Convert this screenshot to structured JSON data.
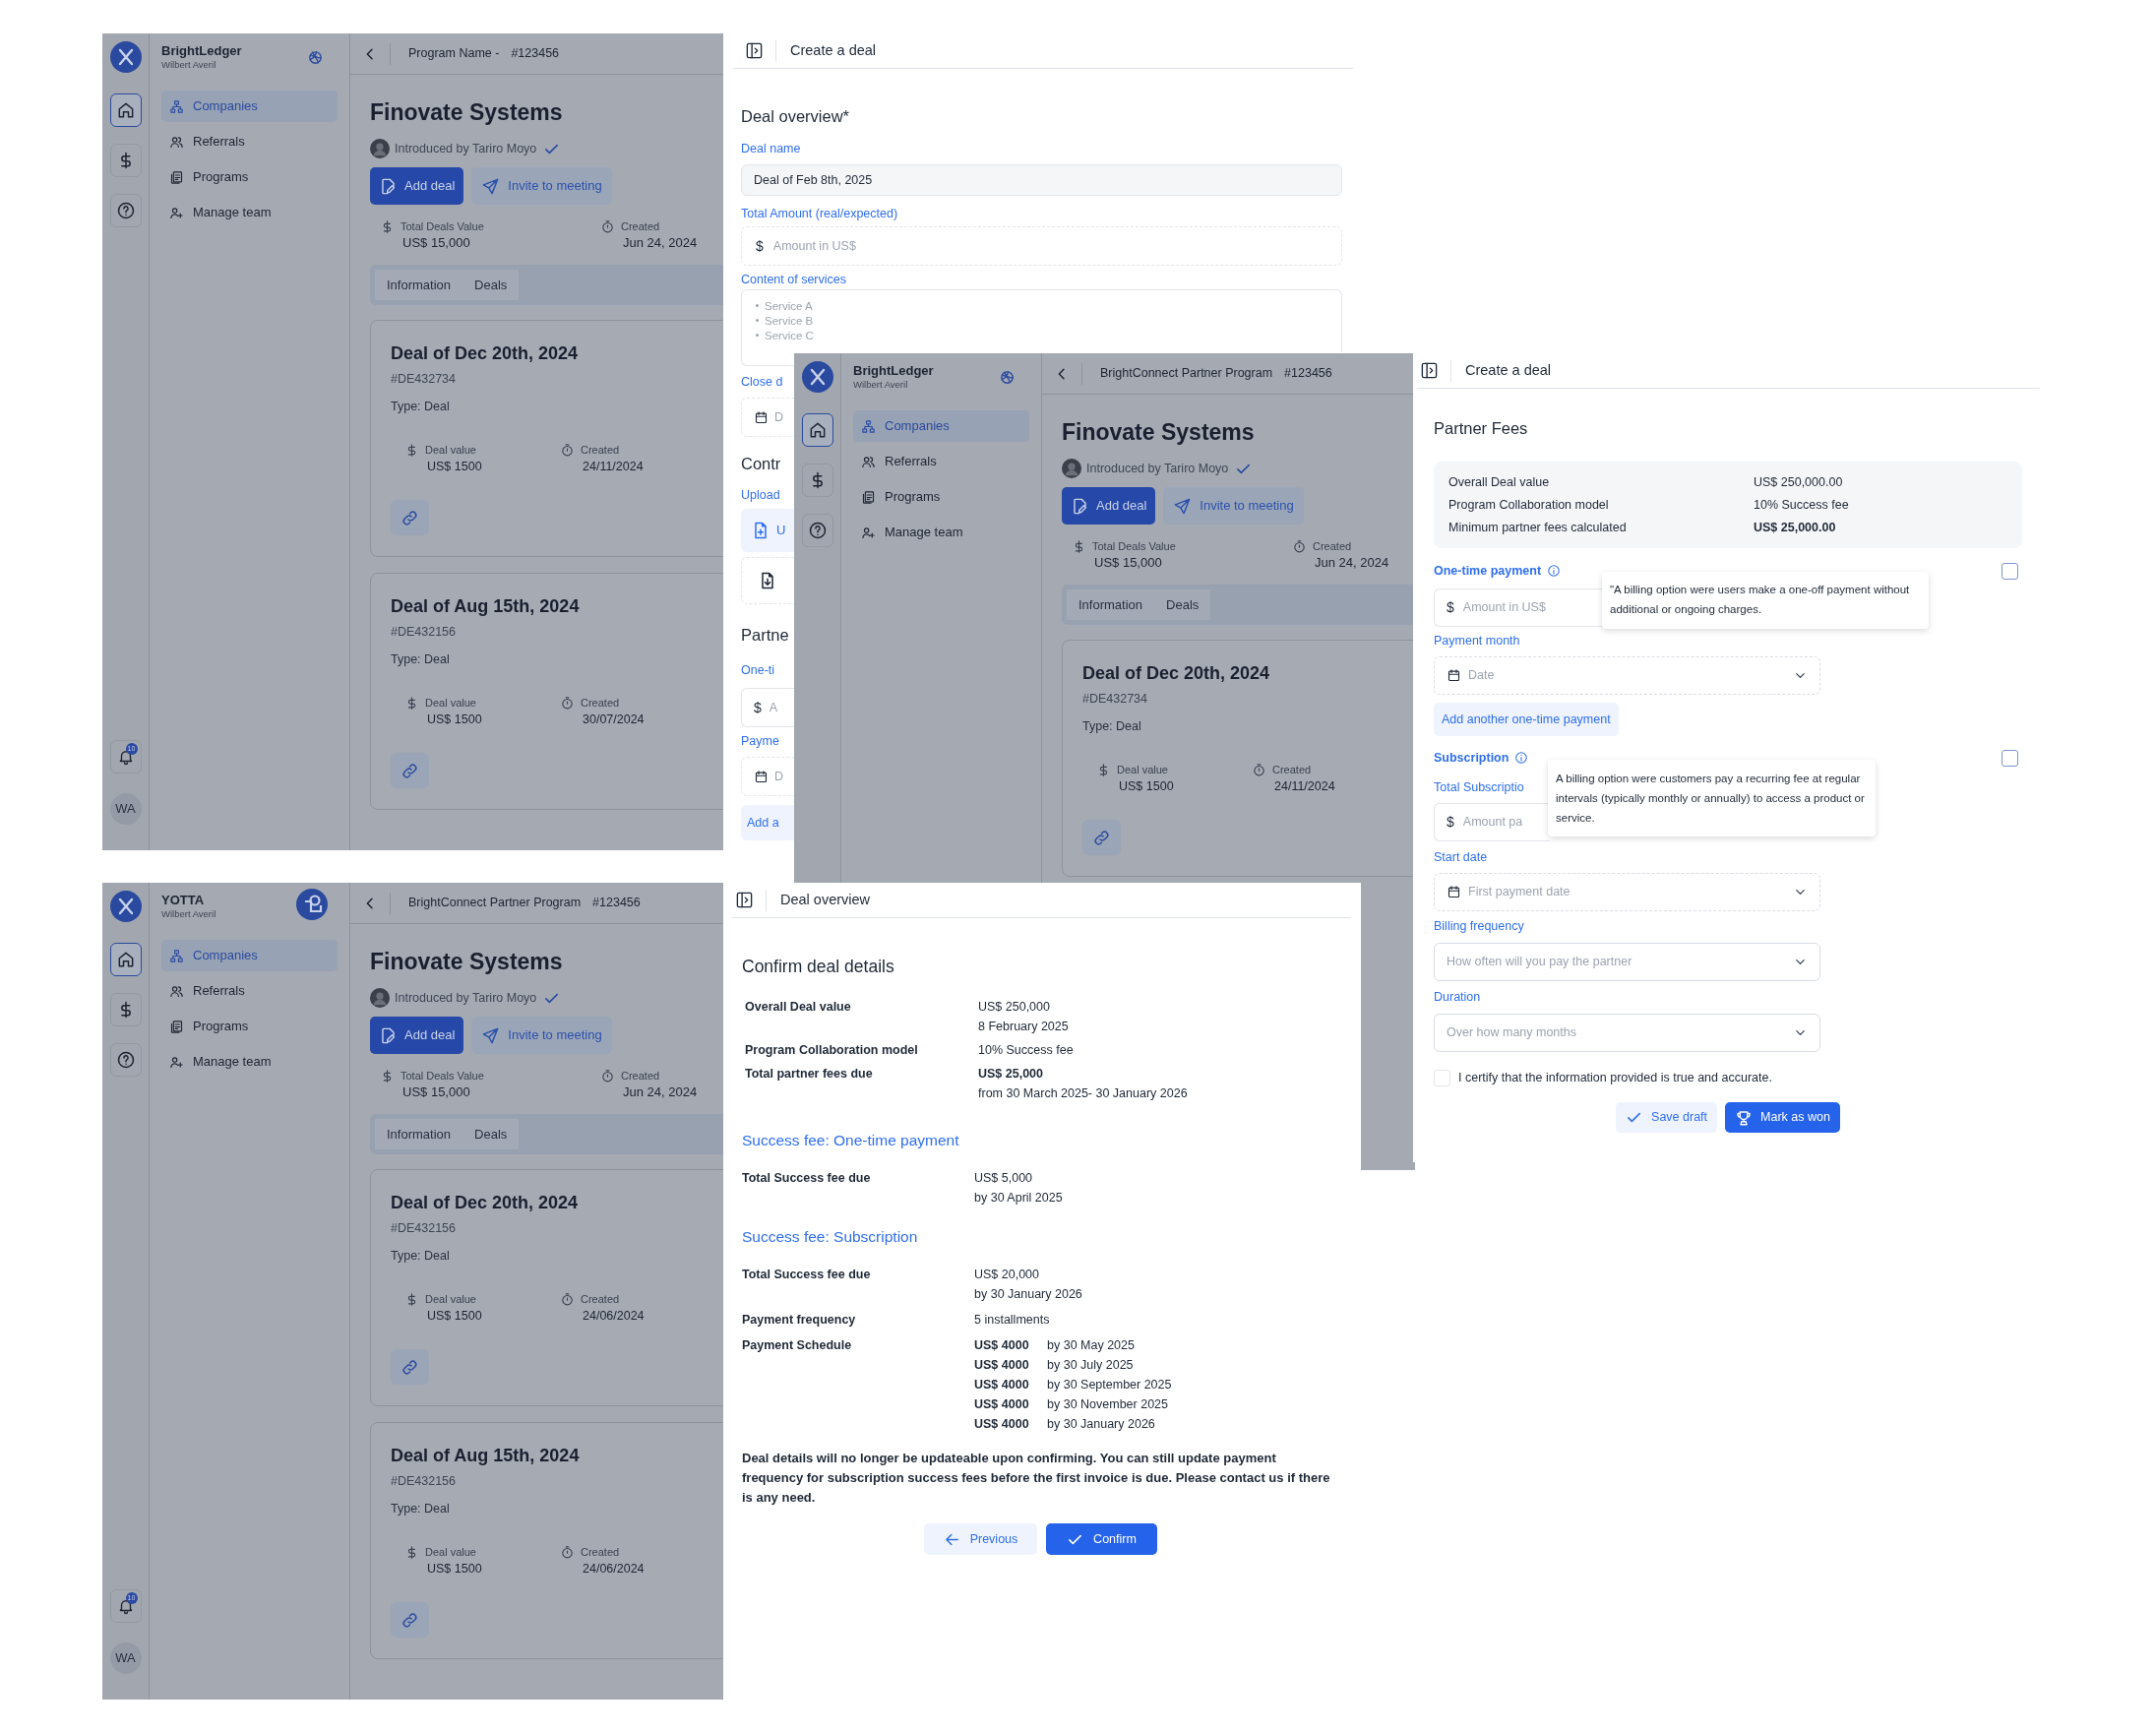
{
  "app_screens": [
    {
      "brand": "BrightLedger",
      "logo": {
        "kind": "knot"
      },
      "user": "Wilbert Averil",
      "program": "Program Name -",
      "program_id": "#123456",
      "rail": [
        {
          "kind": "home",
          "selected": true
        },
        {
          "kind": "dollar",
          "selected": false
        },
        {
          "kind": "help",
          "selected": false
        }
      ],
      "notification_count": "10",
      "avatar": "WA",
      "nav": [
        {
          "kind": "org",
          "label": "Companies",
          "selected": true
        },
        {
          "kind": "users",
          "label": "Referrals",
          "selected": false
        },
        {
          "kind": "docs",
          "label": "Programs",
          "selected": false
        },
        {
          "kind": "userplus",
          "label": "Manage team",
          "selected": false
        }
      ],
      "company": "Finovate Systems",
      "introduced_by": "Introduced by Tariro Moyo",
      "actions": [
        "Add deal",
        "Invite to meeting"
      ],
      "stats": [
        {
          "kind": "dollar",
          "label": "Total Deals Value",
          "value": "US$ 15,000"
        },
        {
          "kind": "timer",
          "label": "Created",
          "value": "Jun 24, 2024"
        }
      ],
      "tabs": [
        {
          "label": "Information",
          "selected": false
        },
        {
          "label": "Deals",
          "selected": false
        }
      ],
      "deals": [
        {
          "title": "Deal of Dec 20th, 2024",
          "id": "#DE432734",
          "type": "Type: Deal",
          "stats": [
            {
              "kind": "dollar",
              "label": "Deal value",
              "value": "US$ 1500"
            },
            {
              "kind": "timer",
              "label": "Created",
              "value": "24/11/2024"
            }
          ]
        },
        {
          "title": "Deal of Aug 15th, 2024",
          "id": "#DE432156",
          "type": "Type: Deal",
          "stats": [
            {
              "kind": "dollar",
              "label": "Deal value",
              "value": "US$ 1500"
            },
            {
              "kind": "timer",
              "label": "Created",
              "value": "30/07/2024"
            }
          ]
        }
      ]
    },
    {
      "brand": "BrightLedger",
      "logo": {
        "kind": "knot"
      },
      "user": "Wilbert Averil",
      "program": "BrightConnect Partner Program",
      "program_id": "#123456",
      "rail": [
        {
          "kind": "home",
          "selected": true
        },
        {
          "kind": "dollar",
          "selected": false
        },
        {
          "kind": "help",
          "selected": false
        }
      ],
      "nav": [
        {
          "kind": "org",
          "label": "Companies",
          "selected": true
        },
        {
          "kind": "users",
          "label": "Referrals",
          "selected": false
        },
        {
          "kind": "docs",
          "label": "Programs",
          "selected": false
        },
        {
          "kind": "userplus",
          "label": "Manage team",
          "selected": false
        }
      ],
      "company": "Finovate Systems",
      "introduced_by": "Introduced by Tariro Moyo",
      "actions": [
        "Add deal",
        "Invite to meeting"
      ],
      "stats": [
        {
          "kind": "dollar",
          "label": "Total Deals Value",
          "value": "US$ 15,000"
        },
        {
          "kind": "timer",
          "label": "Created",
          "value": "Jun 24, 2024"
        }
      ],
      "tabs": [
        {
          "label": "Information",
          "selected": false
        },
        {
          "label": "Deals",
          "selected": false
        }
      ],
      "deals": [
        {
          "title": "Deal of Dec 20th, 2024",
          "id": "#DE432734",
          "type": "Type: Deal",
          "stats": [
            {
              "kind": "dollar",
              "label": "Deal value",
              "value": "US$ 1500"
            },
            {
              "kind": "timer",
              "label": "Created",
              "value": "24/11/2024"
            }
          ]
        }
      ]
    },
    {
      "brand": "YOTTA",
      "logo": {
        "kind": "badge"
      },
      "user": "Wilbert Averil",
      "program": "BrightConnect Partner Program",
      "program_id": "#123456",
      "rail": [
        {
          "kind": "home",
          "selected": true
        },
        {
          "kind": "dollar",
          "selected": false
        },
        {
          "kind": "help",
          "selected": false
        }
      ],
      "notification_count": "10",
      "avatar": "WA",
      "nav": [
        {
          "kind": "org",
          "label": "Companies",
          "selected": true
        },
        {
          "kind": "users",
          "label": "Referrals",
          "selected": false
        },
        {
          "kind": "docs",
          "label": "Programs",
          "selected": false
        },
        {
          "kind": "userplus",
          "label": "Manage team",
          "selected": false
        }
      ],
      "company": "Finovate Systems",
      "introduced_by": "Introduced by Tariro Moyo",
      "actions": [
        "Add deal",
        "Invite to meeting"
      ],
      "stats": [
        {
          "kind": "dollar",
          "label": "Total Deals Value",
          "value": "US$ 15,000"
        },
        {
          "kind": "timer",
          "label": "Created",
          "value": "Jun 24, 2024"
        }
      ],
      "tabs": [
        {
          "label": "Information",
          "selected": false
        },
        {
          "label": "Deals",
          "selected": false
        }
      ],
      "deals": [
        {
          "title": "Deal of Dec 20th, 2024",
          "id": "#DE432156",
          "type": "Type: Deal",
          "stats": [
            {
              "kind": "dollar",
              "label": "Deal value",
              "value": "US$ 1500"
            },
            {
              "kind": "timer",
              "label": "Created",
              "value": "24/06/2024"
            }
          ]
        },
        {
          "title": "Deal of Aug 15th, 2024",
          "id": "#DE432156",
          "type": "Type: Deal",
          "stats": [
            {
              "kind": "dollar",
              "label": "Deal value",
              "value": "US$ 1500"
            },
            {
              "kind": "timer",
              "label": "Created",
              "value": "24/06/2024"
            }
          ]
        }
      ]
    }
  ],
  "create_deal_form": {
    "title": "Create a deal",
    "section": "Deal overview*",
    "deal_name": {
      "label": "Deal name",
      "value": "Deal of Feb 8th, 2025"
    },
    "total_amount": {
      "label": "Total Amount (real/expected)",
      "prefix": "$",
      "placeholder": "Amount in US$"
    },
    "services": {
      "label": "Content of services",
      "items": [
        "Service A",
        "Service B",
        "Service C"
      ]
    },
    "covered_items": [
      {
        "kind": "label",
        "text": "Close d"
      },
      {
        "kind": "date",
        "text": "D"
      },
      {
        "kind": "heading",
        "text": "Contr"
      },
      {
        "kind": "label",
        "text": "Upload"
      },
      {
        "kind": "upload",
        "text": "U"
      },
      {
        "kind": "download"
      },
      {
        "kind": "heading",
        "text": "Partne"
      },
      {
        "kind": "label",
        "text": "One-ti"
      },
      {
        "kind": "amount",
        "prefix": "$",
        "text": "A"
      },
      {
        "kind": "label",
        "text": "Payme"
      },
      {
        "kind": "date",
        "text": "D"
      },
      {
        "kind": "button",
        "text": "Add a"
      }
    ]
  },
  "partner_fees_form": {
    "title": "Create a deal",
    "section": "Partner Fees",
    "summary": [
      {
        "label": "Overall Deal value",
        "value": "US$ 250,000.00",
        "bold": false
      },
      {
        "label": "Program Collaboration model",
        "value": "10% Success fee",
        "bold": false
      },
      {
        "label": "Minimum partner fees calculated",
        "value": "US$ 25,000.00",
        "bold": true
      }
    ],
    "one_time": {
      "label": "One-time payment",
      "checked": false,
      "prefix": "$",
      "amount_placeholder": "Amount in US$",
      "tooltip": "\"A billing option were users make a one-off payment without additional or ongoing charges.",
      "month_label": "Payment month",
      "month_placeholder": "Date",
      "add_button": "Add another one-time payment"
    },
    "subscription": {
      "label": "Subscription",
      "checked": false,
      "total_label": "Total Subscriptio",
      "prefix": "$",
      "amount_placeholder": "Amount pa",
      "tooltip": "A billing option were customers pay a recurring fee at regular intervals (typically monthly or annually) to access a product or service."
    },
    "selects": [
      {
        "kind": "date",
        "label": "Start date",
        "placeholder": "First payment date"
      },
      {
        "kind": "plain",
        "label": "Billing frequency",
        "placeholder": "How often will you pay the partner"
      },
      {
        "kind": "plain",
        "label": "Duration",
        "placeholder": "Over how many months"
      }
    ],
    "certify": {
      "text": "I certify that the information provided is true and accurate.",
      "checked": false
    },
    "buttons": [
      "Save draft",
      "Mark as won"
    ]
  },
  "deal_overview": {
    "title": "Deal overview",
    "heading": "Confirm deal details",
    "summary": [
      {
        "label": "Overall Deal value",
        "values": [
          {
            "text": "US$ 250,000",
            "bold": false
          },
          {
            "text": "8 February 2025",
            "bold": false
          }
        ]
      },
      {
        "label": "Program Collaboration model",
        "values": [
          {
            "text": "10% Success fee",
            "bold": false
          }
        ]
      },
      {
        "label": "Total partner fees due",
        "values": [
          {
            "text": "US$ 25,000",
            "bold": true
          },
          {
            "text": "from 30 March 2025- 30 January 2026",
            "bold": false
          }
        ]
      }
    ],
    "sections": [
      {
        "title": "Success fee: One-time payment",
        "rows": [
          {
            "label": "Total Success fee due",
            "values": [
              "US$ 5,000",
              "by 30 April 2025"
            ]
          }
        ]
      },
      {
        "title": "Success fee: Subscription",
        "rows": [
          {
            "label": "Total Success fee due",
            "values": [
              "US$ 20,000",
              "by 30 January 2026"
            ]
          },
          {
            "label": "Payment frequency",
            "values": [
              "5 installments"
            ]
          }
        ],
        "schedule": {
          "label": "Payment Schedule",
          "items": [
            {
              "amount": "US$ 4000",
              "due": "by 30 May 2025"
            },
            {
              "amount": "US$ 4000",
              "due": "by 30 July 2025"
            },
            {
              "amount": "US$ 4000",
              "due": "by 30 September 2025"
            },
            {
              "amount": "US$ 4000",
              "due": "by 30 November 2025"
            },
            {
              "amount": "US$ 4000",
              "due": "by 30 January 2026"
            }
          ]
        }
      }
    ],
    "note": "Deal details will no longer be updateable upon confirming. You can still update payment frequency for subscription success fees before the first invoice is due. Please contact us if there is any need.",
    "buttons": [
      "Previous",
      "Confirm"
    ]
  }
}
